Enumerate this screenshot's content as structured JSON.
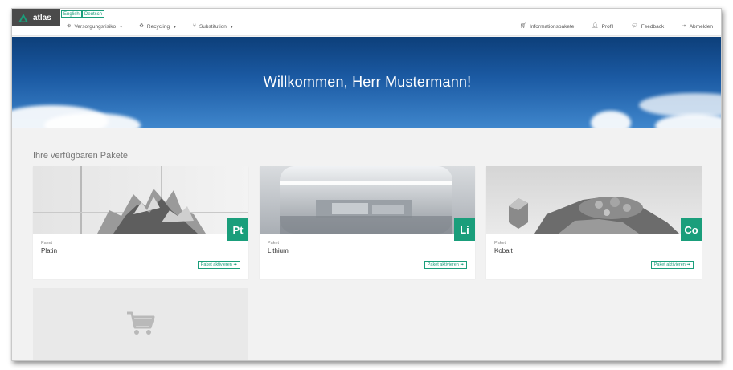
{
  "brand": {
    "name": "atlas"
  },
  "languages": [
    "English",
    "Deutsch"
  ],
  "nav_left": [
    {
      "label": "Versorgungsrisiko",
      "icon": "globe-icon"
    },
    {
      "label": "Recycling",
      "icon": "recycle-icon"
    },
    {
      "label": "Substitution",
      "icon": "substitution-icon"
    }
  ],
  "nav_right": [
    {
      "label": "Informationspakete",
      "icon": "cart-icon"
    },
    {
      "label": "Profil",
      "icon": "user-icon"
    },
    {
      "label": "Feedback",
      "icon": "chat-icon"
    },
    {
      "label": "Abmelden",
      "icon": "logout-icon"
    }
  ],
  "hero": {
    "title": "Willkommen, Herr Mustermann!"
  },
  "packages": {
    "title": "Ihre verfügbaren Pakete",
    "items": [
      {
        "kind": "Paket",
        "name": "Platin",
        "symbol": "Pt",
        "action": "Paket aktivieren ➟"
      },
      {
        "kind": "Paket",
        "name": "Lithium",
        "symbol": "Li",
        "action": "Paket aktivieren ➟"
      },
      {
        "kind": "Paket",
        "name": "Kobalt",
        "symbol": "Co",
        "action": "Paket aktivieren ➟"
      }
    ],
    "empty_icon": "cart-icon"
  },
  "colors": {
    "accent": "#1a9e7b",
    "brand_bg": "#4a4a4a",
    "hero": "#1b5aa3"
  }
}
